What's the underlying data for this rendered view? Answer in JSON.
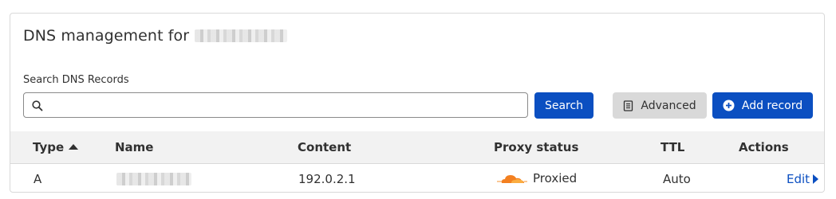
{
  "header": {
    "title": "DNS management for"
  },
  "search": {
    "label": "Search DNS Records",
    "value": "",
    "placeholder": "",
    "button_label": "Search"
  },
  "toolbar": {
    "advanced_label": "Advanced",
    "add_record_label": "Add record"
  },
  "table": {
    "columns": [
      "Type",
      "Name",
      "Content",
      "Proxy status",
      "TTL",
      "Actions"
    ],
    "sort_column": "Type",
    "sort_direction": "ascending",
    "rows": [
      {
        "type": "A",
        "content": "192.0.2.1",
        "proxy_status": "Proxied",
        "ttl": "Auto",
        "action_label": "Edit"
      }
    ]
  },
  "icons": {
    "search": "magnifier-icon",
    "advanced": "document-icon",
    "add": "plus-circle-icon",
    "proxy": "orange-cloud-icon",
    "edit": "caret-right-icon"
  },
  "colors": {
    "primary": "#0b4fc1",
    "cloud": "#f38020",
    "header_bg": "#f2f2f2"
  }
}
